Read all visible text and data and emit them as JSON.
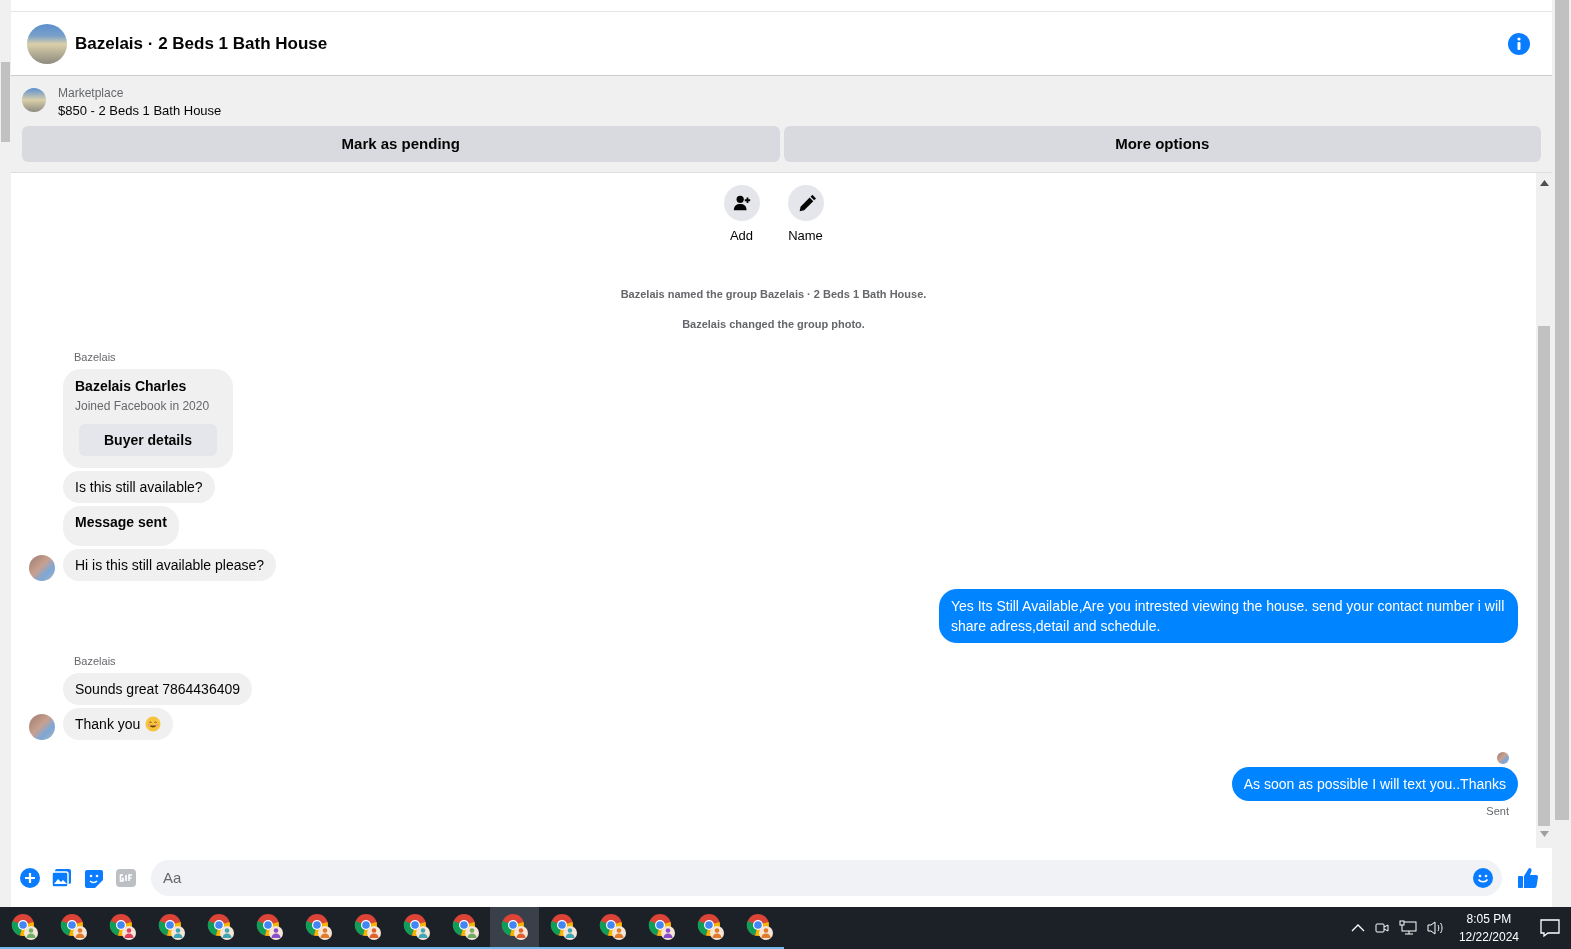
{
  "header": {
    "title": "Bazelais · 2 Beds 1 Bath House"
  },
  "listing": {
    "source": "Marketplace",
    "title": "$850 - 2 Beds 1 Bath House",
    "buttons": [
      "Mark as pending",
      "More options"
    ]
  },
  "group_actions": [
    {
      "kind": "add",
      "label": "Add"
    },
    {
      "kind": "name",
      "label": "Name"
    }
  ],
  "messages": [
    {
      "kind": "system",
      "text": "Bazelais named the group Bazelais · 2 Beds 1 Bath House."
    },
    {
      "kind": "system",
      "text": "Bazelais changed the group photo."
    },
    {
      "kind": "sender",
      "text": "Bazelais"
    },
    {
      "kind": "card",
      "name": "Bazelais Charles",
      "subtitle": "Joined Facebook in 2020",
      "button": "Buyer details"
    },
    {
      "kind": "incoming",
      "text": "Is this still available?",
      "bold": false,
      "avatar": false
    },
    {
      "kind": "incoming",
      "text": "Message sent",
      "bold": true,
      "avatar": false
    },
    {
      "kind": "incoming",
      "text": "Hi is this still available please?",
      "bold": false,
      "avatar": true
    },
    {
      "kind": "outgoing",
      "text": "Yes Its Still Available,Are you intrested viewing the house. send your contact number i will share adress,detail and schedule."
    },
    {
      "kind": "sender",
      "text": "Bazelais"
    },
    {
      "kind": "incoming",
      "text": "Sounds great 7864436409",
      "bold": false,
      "avatar": false
    },
    {
      "kind": "incoming",
      "text": "Thank you",
      "bold": false,
      "avatar": true,
      "emoji": true
    },
    {
      "kind": "seen"
    },
    {
      "kind": "outgoing",
      "text": "As soon as possible I will text you..Thanks"
    },
    {
      "kind": "status",
      "text": "Sent"
    }
  ],
  "composer": {
    "placeholder": "Aa"
  },
  "taskbar": {
    "apps": [
      {
        "selected": false
      },
      {
        "selected": false
      },
      {
        "selected": false
      },
      {
        "selected": false
      },
      {
        "selected": false
      },
      {
        "selected": false
      },
      {
        "selected": false
      },
      {
        "selected": false
      },
      {
        "selected": false
      },
      {
        "selected": false
      },
      {
        "selected": true
      },
      {
        "selected": false
      },
      {
        "selected": false
      },
      {
        "selected": false
      },
      {
        "selected": false
      },
      {
        "selected": false
      }
    ],
    "time": "8:05 PM",
    "date": "12/22/2024"
  }
}
